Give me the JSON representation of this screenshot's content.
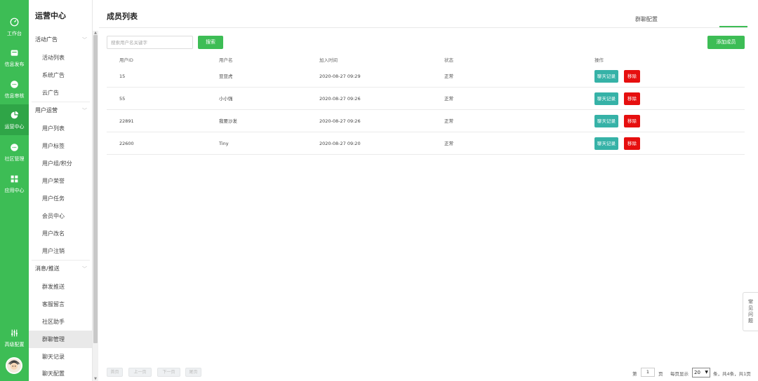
{
  "rail": {
    "items": [
      {
        "label": "工作台",
        "icon": "dashboard-icon"
      },
      {
        "label": "信息发布",
        "icon": "publish-icon"
      },
      {
        "label": "信息审核",
        "icon": "chat-bubble-icon"
      },
      {
        "label": "运营中心",
        "icon": "pie-chart-icon"
      },
      {
        "label": "社区管理",
        "icon": "community-icon"
      },
      {
        "label": "应用中心",
        "icon": "apps-grid-icon"
      },
      {
        "label": "高级配置",
        "icon": "sliders-icon"
      }
    ],
    "active_index": 3
  },
  "submenu": {
    "title": "运营中心",
    "groups": [
      {
        "label": "活动广告",
        "items": [
          "活动列表",
          "系统广告",
          "云广告"
        ]
      },
      {
        "label": "用户运营",
        "items": [
          "用户列表",
          "用户标签",
          "用户组/积分",
          "用户荣誉",
          "用户任务",
          "会员中心",
          "用户改名",
          "用户注销"
        ]
      },
      {
        "label": "消息/推送",
        "items": [
          "群发推送",
          "客服留言",
          "社区助手",
          "群聊管理",
          "聊天记录",
          "聊天配置"
        ]
      }
    ],
    "active_item": "群聊管理"
  },
  "main": {
    "title": "成员列表",
    "tab_right": "群聊配置",
    "search": {
      "placeholder": "搜索用户名关键字",
      "button": "搜索"
    },
    "add_button": "添加成员",
    "table": {
      "headers": [
        "用户ID",
        "用户名",
        "加入时间",
        "状态",
        "操作"
      ],
      "rows": [
        {
          "id": "15",
          "name": "豆豆虎",
          "time": "2020-08-27 09:29",
          "status": "正常"
        },
        {
          "id": "55",
          "name": "小小强",
          "time": "2020-08-27 09:26",
          "status": "正常"
        },
        {
          "id": "22891",
          "name": "我要沙发",
          "time": "2020-08-27 09:26",
          "status": "正常"
        },
        {
          "id": "22600",
          "name": "Tiny",
          "time": "2020-08-27 09:20",
          "status": "正常"
        }
      ],
      "actions": {
        "chat": "聊天记录",
        "remove": "移除"
      }
    },
    "pagination": {
      "first": "首页",
      "prev": "上一页",
      "next": "下一页",
      "last": "尾页",
      "page_prefix": "第",
      "page": "1",
      "page_suffix": "页",
      "per_page_label": "每页显示",
      "per_page": "20",
      "summary": "条，共4条，共1页"
    }
  },
  "faq": {
    "chars": [
      "常",
      "见",
      "问",
      "题"
    ]
  },
  "colors": {
    "brand": "#3dbd55",
    "chat_button": "#36b2a7",
    "remove_button": "#e60f0f"
  }
}
